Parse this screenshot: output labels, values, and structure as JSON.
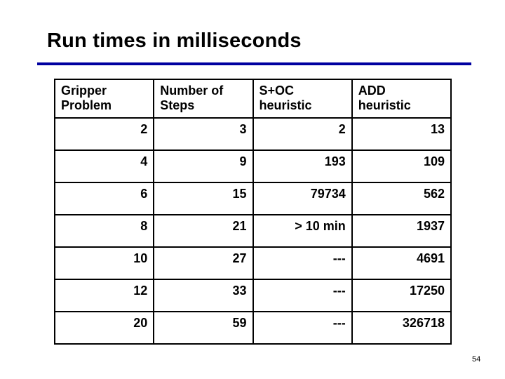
{
  "slide": {
    "title": "Run times in milliseconds",
    "rule_color": "#0000a0",
    "page_number": "54"
  },
  "table": {
    "headers": [
      [
        "Gripper",
        "Problem"
      ],
      [
        "Number of",
        "Steps"
      ],
      [
        "S+OC",
        "heuristic"
      ],
      [
        "ADD",
        "heuristic"
      ]
    ],
    "rows": [
      [
        "2",
        "3",
        "2",
        "13"
      ],
      [
        "4",
        "9",
        "193",
        "109"
      ],
      [
        "6",
        "15",
        "79734",
        "562"
      ],
      [
        "8",
        "21",
        "> 10 min",
        "1937"
      ],
      [
        "10",
        "27",
        "---",
        "4691"
      ],
      [
        "12",
        "33",
        "---",
        "17250"
      ],
      [
        "20",
        "59",
        "---",
        "326718"
      ]
    ]
  }
}
